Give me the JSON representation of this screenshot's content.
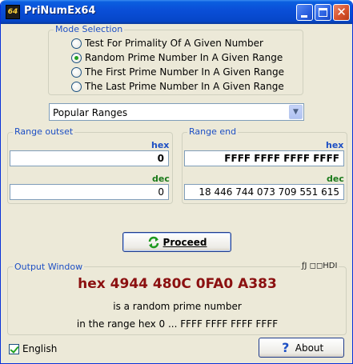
{
  "window": {
    "title": "PriNumEx64",
    "icon": "app-logo-icon"
  },
  "mode_selection": {
    "legend": "Mode Selection",
    "options": [
      {
        "label": "Test For Primality Of A Given Number",
        "checked": false
      },
      {
        "label": "Random Prime Number In A Given Range",
        "checked": true
      },
      {
        "label": "The First Prime Number In A Given Range",
        "checked": false
      },
      {
        "label": "The Last Prime Number In A Given Range",
        "checked": false
      }
    ]
  },
  "ranges_dropdown": {
    "selected": "Popular Ranges"
  },
  "range_outset": {
    "legend": "Range outset",
    "hex_label": "hex",
    "hex_value": "0",
    "dec_label": "dec",
    "dec_value": "0"
  },
  "range_end": {
    "legend": "Range end",
    "hex_label": "hex",
    "hex_value": "FFFF FFFF FFFF FFFF",
    "dec_label": "dec",
    "dec_value": "18 446 744 073 709 551 615"
  },
  "proceed_button": {
    "label": "Proceed"
  },
  "output": {
    "legend": "Output Window",
    "status": "ƒJ ◻◻HDI",
    "result": "hex 4944 480C 0FA0 A383",
    "line1": "is a random prime number",
    "line2": "in the range hex 0 ... FFFF FFFF FFFF FFFF"
  },
  "language_checkbox": {
    "label": "English",
    "checked": true
  },
  "about_button": {
    "label": "About"
  },
  "colors": {
    "title_bar": "#0a4fd8",
    "legend_text": "#1d4fc4",
    "hex_label": "#1d4fc4",
    "dec_label": "#1a7a1a",
    "result_text": "#8b1010",
    "radio_dot": "#21a121"
  }
}
